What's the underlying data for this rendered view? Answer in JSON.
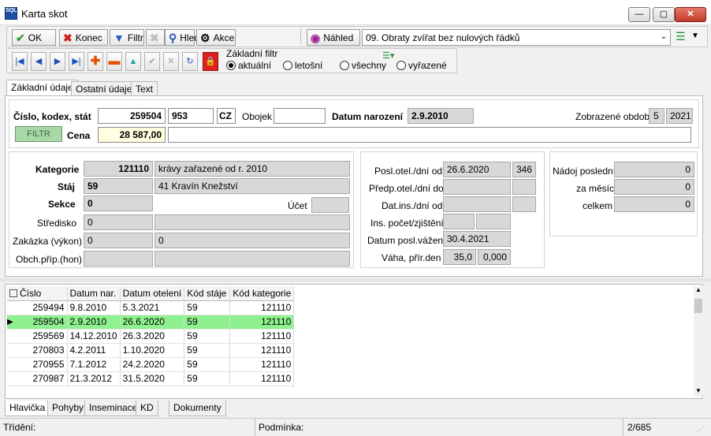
{
  "window": {
    "app_icon_text": "SQL",
    "title": "Karta skot",
    "buttons": {
      "minimize": "—",
      "maximize": "▢",
      "close": "✕"
    }
  },
  "toolbar": {
    "ok": "OK",
    "konec": "Konec",
    "filtr": "Filtr",
    "hled": "Hled",
    "akce": "Akce",
    "nahled": "Náhled",
    "report_value": "09. Obraty zvířat bez nulových řádků"
  },
  "nav": {
    "zakladni_filtr": "Základní filtr",
    "aktualni": "aktuální",
    "letosni": "letošní",
    "vsechny": "všechny",
    "vyrazene": "vyřazené"
  },
  "tabs": [
    "Základní údaje",
    "Ostatní údaje",
    "Text"
  ],
  "header": {
    "cislo_label": "Číslo, kodex, stát",
    "cislo": "259504",
    "kodex": "953",
    "stat": "CZ",
    "obojek_label": "Obojek",
    "obojek": "",
    "datum_narozeni_label": "Datum narození",
    "datum_narozeni": "2.9.2010",
    "zobrazene_obdobi_label": "Zobrazené období",
    "obdobi_mesic": "5",
    "obdobi_rok": "2021",
    "filtr_btn": "FILTR",
    "cena_label": "Cena",
    "cena": "28 587,00",
    "poznamka": ""
  },
  "left_group": {
    "kategorie_label": "Kategorie",
    "kategorie_kod": "121110",
    "kategorie_text": "krávy zařazené od r. 2010",
    "staj_label": "Stáj",
    "staj_kod": "59",
    "staj_text": "41 Kravín Knežství",
    "sekce_label": "Sekce",
    "sekce": "0",
    "ucet_label": "Účet",
    "ucet": "",
    "stredisko_label": "Středisko",
    "stredisko": "0",
    "stredisko_text": "",
    "zakazka_label": "Zakázka (výkon)",
    "zakazka": "0",
    "zakazka_text": "0",
    "obch_label": "Obch.příp.(hon)",
    "obch": "",
    "obch_text": ""
  },
  "mid_group": {
    "posl_otel_label": "Posl.otel./dní od",
    "posl_otel": "26.6.2020",
    "posl_otel_dni": "346",
    "predp_otel_label": "Předp.otel./dní do",
    "predp_otel": "",
    "predp_otel_dni": "",
    "dat_ins_label": "Dat.ins./dní od",
    "dat_ins": "",
    "dat_ins_dni": "",
    "ins_pocet_label": "Ins. počet/zjištění",
    "ins_pocet": "",
    "ins_zjisteni": "",
    "vazeni_label": "Datum posl.vážení",
    "vazeni": "30.4.2021",
    "vaha_label": "Váha, přír.den",
    "vaha": "35,0",
    "prir_den": "0,000"
  },
  "right_group": {
    "nadoj_posledni_label": "Nádoj poslední",
    "nadoj_posledni": "0",
    "za_mesic_label": "za měsíc",
    "za_mesic": "0",
    "celkem_label": "celkem",
    "celkem": "0"
  },
  "grid": {
    "columns": [
      "Číslo",
      "Datum nar.",
      "Datum otelení",
      "Kód stáje",
      "Kód kategorie"
    ],
    "rows": [
      [
        "259494",
        "9.8.2010",
        "5.3.2021",
        "59",
        "121110"
      ],
      [
        "259504",
        "2.9.2010",
        "26.6.2020",
        "59",
        "121110"
      ],
      [
        "259569",
        "14.12.2010",
        "26.3.2020",
        "59",
        "121110"
      ],
      [
        "270803",
        "4.2.2011",
        "1.10.2020",
        "59",
        "121110"
      ],
      [
        "270955",
        "7.1.2012",
        "24.2.2020",
        "59",
        "121110"
      ],
      [
        "270987",
        "21.3.2012",
        "31.5.2020",
        "59",
        "121110"
      ]
    ],
    "selected_row": 1
  },
  "bottom_tabs": [
    "Hlavička",
    "Pohyby",
    "Inseminace",
    "KD",
    "Dokumenty"
  ],
  "status": {
    "trideni_label": "Třídění:",
    "podminka_label": "Podmínka:",
    "records": "2/685"
  },
  "colors": {
    "selected_row": "#8ef08e",
    "ok_check": "#2e9e2e",
    "konec_x": "#d02020",
    "lock": "#e02020"
  }
}
